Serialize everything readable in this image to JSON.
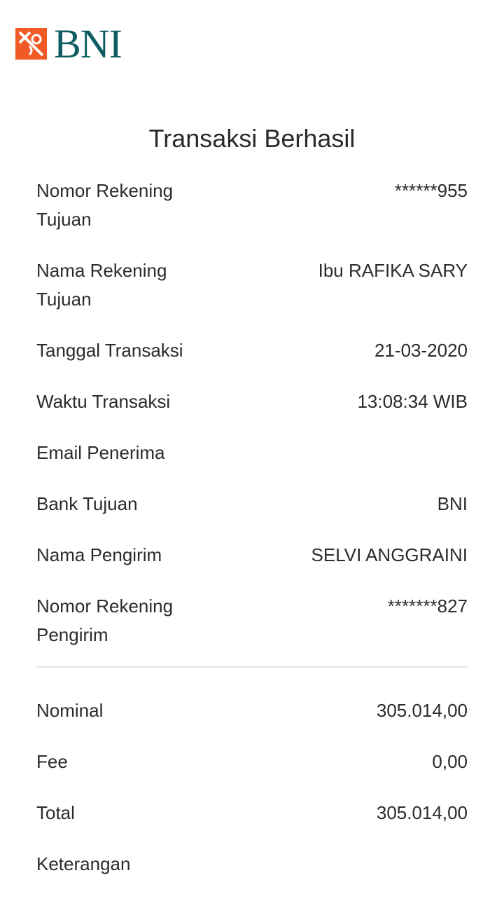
{
  "brand": {
    "name": "BNI",
    "logo_icon": "bni-logo-icon",
    "text_color": "#0d5c63",
    "accent_color": "#f15a24"
  },
  "title": "Transaksi Berhasil",
  "details": [
    {
      "label_line1": "Nomor Rekening",
      "label_line2": "Tujuan",
      "value": "******955"
    },
    {
      "label_line1": "Nama Rekening",
      "label_line2": "Tujuan",
      "value": "Ibu RAFIKA SARY"
    },
    {
      "label_line1": "Tanggal Transaksi",
      "label_line2": "",
      "value": "21-03-2020"
    },
    {
      "label_line1": "Waktu Transaksi",
      "label_line2": "",
      "value": "13:08:34 WIB"
    },
    {
      "label_line1": "Email Penerima",
      "label_line2": "",
      "value": ""
    },
    {
      "label_line1": "Bank Tujuan",
      "label_line2": "",
      "value": "BNI"
    },
    {
      "label_line1": "Nama Pengirim",
      "label_line2": "",
      "value": "SELVI ANGGRAINI"
    },
    {
      "label_line1": "Nomor Rekening",
      "label_line2": "Pengirim",
      "value": "*******827"
    }
  ],
  "amounts": [
    {
      "label": "Nominal",
      "value": "305.014,00"
    },
    {
      "label": "Fee",
      "value": "0,00"
    },
    {
      "label": "Total",
      "value": "305.014,00"
    },
    {
      "label": "Keterangan",
      "value": ""
    }
  ]
}
